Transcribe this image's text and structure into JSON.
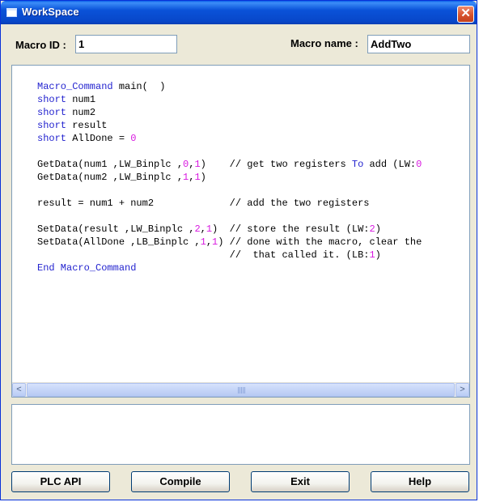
{
  "window": {
    "title": "WorkSpace",
    "close_glyph": "✕"
  },
  "header": {
    "macro_id_label": "Macro ID :",
    "macro_id_value": "1",
    "macro_name_label": "Macro name :",
    "macro_name_value": "AddTwo"
  },
  "code": {
    "lines": [
      [
        {
          "t": "Macro_Command",
          "c": "kw"
        },
        {
          "t": " main(  )"
        }
      ],
      [
        {
          "t": "short",
          "c": "kw"
        },
        {
          "t": " num1"
        }
      ],
      [
        {
          "t": "short",
          "c": "kw"
        },
        {
          "t": " num2"
        }
      ],
      [
        {
          "t": "short",
          "c": "kw"
        },
        {
          "t": " result"
        }
      ],
      [
        {
          "t": "short",
          "c": "kw"
        },
        {
          "t": " AllDone = "
        },
        {
          "t": "0",
          "c": "num"
        }
      ],
      [],
      [
        {
          "t": "GetData(num1 ,LW_Binplc ,"
        },
        {
          "t": "0",
          "c": "num"
        },
        {
          "t": ","
        },
        {
          "t": "1",
          "c": "num"
        },
        {
          "t": ")    // get two registers "
        },
        {
          "t": "To",
          "c": "kw"
        },
        {
          "t": " add (LW:"
        },
        {
          "t": "0",
          "c": "num"
        }
      ],
      [
        {
          "t": "GetData(num2 ,LW_Binplc ,"
        },
        {
          "t": "1",
          "c": "num"
        },
        {
          "t": ","
        },
        {
          "t": "1",
          "c": "num"
        },
        {
          "t": ")"
        }
      ],
      [],
      [
        {
          "t": "result = num1 + num2             // add the two registers"
        }
      ],
      [],
      [
        {
          "t": "SetData(result ,LW_Binplc ,"
        },
        {
          "t": "2",
          "c": "num"
        },
        {
          "t": ","
        },
        {
          "t": "1",
          "c": "num"
        },
        {
          "t": ")  // store the result (LW:"
        },
        {
          "t": "2",
          "c": "num"
        },
        {
          "t": ")"
        }
      ],
      [
        {
          "t": "SetData(AllDone ,LB_Binplc ,"
        },
        {
          "t": "1",
          "c": "num"
        },
        {
          "t": ","
        },
        {
          "t": "1",
          "c": "num"
        },
        {
          "t": ") // done with the macro, clear the"
        }
      ],
      [
        {
          "t": "                                 //  that called it. (LB:"
        },
        {
          "t": "1",
          "c": "num"
        },
        {
          "t": ")"
        }
      ],
      [
        {
          "t": "End Macro_Command",
          "c": "kw"
        }
      ]
    ]
  },
  "scrollbar": {
    "left_arrow": "<",
    "right_arrow": ">"
  },
  "output": {
    "text": ""
  },
  "buttons": {
    "plc_api": "PLC API",
    "compile": "Compile",
    "exit": "Exit",
    "help": "Help"
  }
}
